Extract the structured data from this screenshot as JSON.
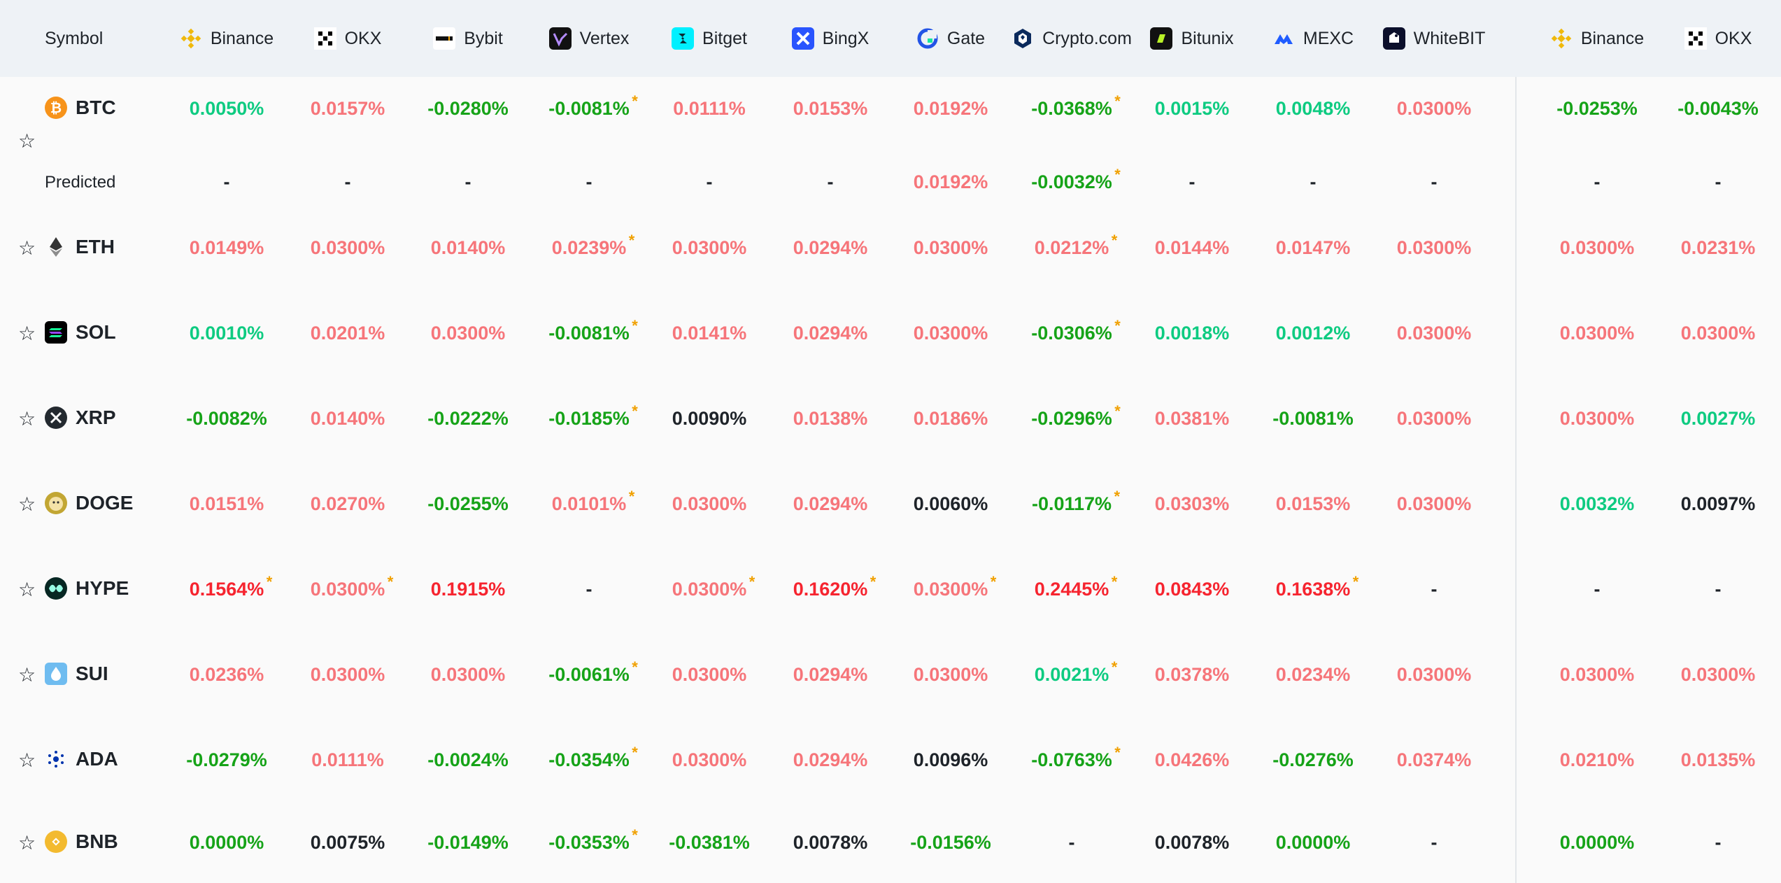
{
  "header": {
    "symbol_label": "Symbol",
    "exchanges": [
      {
        "name": "Binance",
        "icon": "binance-icon"
      },
      {
        "name": "OKX",
        "icon": "okx-icon"
      },
      {
        "name": "Bybit",
        "icon": "bybit-icon"
      },
      {
        "name": "Vertex",
        "icon": "vertex-icon"
      },
      {
        "name": "Bitget",
        "icon": "bitget-icon"
      },
      {
        "name": "BingX",
        "icon": "bingx-icon"
      },
      {
        "name": "Gate",
        "icon": "gate-icon"
      },
      {
        "name": "Crypto.com",
        "icon": "cryptocom-icon"
      },
      {
        "name": "Bitunix",
        "icon": "bitunix-icon"
      },
      {
        "name": "MEXC",
        "icon": "mexc-icon"
      },
      {
        "name": "WhiteBIT",
        "icon": "whitebit-icon"
      },
      {
        "name": "Binance",
        "icon": "binance-icon"
      },
      {
        "name": "OKX",
        "icon": "okx-icon"
      }
    ]
  },
  "predicted_label": "Predicted",
  "colors": {
    "positive_low": "#0ecb81",
    "negative": "#16a318",
    "positive": "#f6757a",
    "high": "#f6242f",
    "neutral": "#1e2329",
    "estimated_marker": "#f0a000"
  },
  "rows": [
    {
      "symbol": "BTC",
      "icon": "btc-icon",
      "rates": [
        {
          "v": "0.0050%",
          "c": "pos-green"
        },
        {
          "v": "0.0157%",
          "c": "pink"
        },
        {
          "v": "-0.0280%",
          "c": "neg-green"
        },
        {
          "v": "-0.0081%",
          "c": "neg-green",
          "a": true
        },
        {
          "v": "0.0111%",
          "c": "pink"
        },
        {
          "v": "0.0153%",
          "c": "pink"
        },
        {
          "v": "0.0192%",
          "c": "pink"
        },
        {
          "v": "-0.0368%",
          "c": "neg-green",
          "a": true
        },
        {
          "v": "0.0015%",
          "c": "pos-green"
        },
        {
          "v": "0.0048%",
          "c": "pos-green"
        },
        {
          "v": "0.0300%",
          "c": "pink"
        },
        {
          "v": "-0.0253%",
          "c": "neg-green"
        },
        {
          "v": "-0.0043%",
          "c": "neg-green"
        }
      ],
      "predicted": [
        {
          "v": "-",
          "c": "dark"
        },
        {
          "v": "-",
          "c": "dark"
        },
        {
          "v": "-",
          "c": "dark"
        },
        {
          "v": "-",
          "c": "dark"
        },
        {
          "v": "-",
          "c": "dark"
        },
        {
          "v": "-",
          "c": "dark"
        },
        {
          "v": "0.0192%",
          "c": "pink"
        },
        {
          "v": "-0.0032%",
          "c": "neg-green",
          "a": true
        },
        {
          "v": "-",
          "c": "dark"
        },
        {
          "v": "-",
          "c": "dark"
        },
        {
          "v": "-",
          "c": "dark"
        },
        {
          "v": "-",
          "c": "dark"
        },
        {
          "v": "-",
          "c": "dark"
        }
      ]
    },
    {
      "symbol": "ETH",
      "icon": "eth-icon",
      "rates": [
        {
          "v": "0.0149%",
          "c": "pink"
        },
        {
          "v": "0.0300%",
          "c": "pink"
        },
        {
          "v": "0.0140%",
          "c": "pink"
        },
        {
          "v": "0.0239%",
          "c": "pink",
          "a": true
        },
        {
          "v": "0.0300%",
          "c": "pink"
        },
        {
          "v": "0.0294%",
          "c": "pink"
        },
        {
          "v": "0.0300%",
          "c": "pink"
        },
        {
          "v": "0.0212%",
          "c": "pink",
          "a": true
        },
        {
          "v": "0.0144%",
          "c": "pink"
        },
        {
          "v": "0.0147%",
          "c": "pink"
        },
        {
          "v": "0.0300%",
          "c": "pink"
        },
        {
          "v": "0.0300%",
          "c": "pink"
        },
        {
          "v": "0.0231%",
          "c": "pink"
        }
      ]
    },
    {
      "symbol": "SOL",
      "icon": "sol-icon",
      "rates": [
        {
          "v": "0.0010%",
          "c": "pos-green"
        },
        {
          "v": "0.0201%",
          "c": "pink"
        },
        {
          "v": "0.0300%",
          "c": "pink"
        },
        {
          "v": "-0.0081%",
          "c": "neg-green",
          "a": true
        },
        {
          "v": "0.0141%",
          "c": "pink"
        },
        {
          "v": "0.0294%",
          "c": "pink"
        },
        {
          "v": "0.0300%",
          "c": "pink"
        },
        {
          "v": "-0.0306%",
          "c": "neg-green",
          "a": true
        },
        {
          "v": "0.0018%",
          "c": "pos-green"
        },
        {
          "v": "0.0012%",
          "c": "pos-green"
        },
        {
          "v": "0.0300%",
          "c": "pink"
        },
        {
          "v": "0.0300%",
          "c": "pink"
        },
        {
          "v": "0.0300%",
          "c": "pink"
        }
      ]
    },
    {
      "symbol": "XRP",
      "icon": "xrp-icon",
      "rates": [
        {
          "v": "-0.0082%",
          "c": "neg-green"
        },
        {
          "v": "0.0140%",
          "c": "pink"
        },
        {
          "v": "-0.0222%",
          "c": "neg-green"
        },
        {
          "v": "-0.0185%",
          "c": "neg-green",
          "a": true
        },
        {
          "v": "0.0090%",
          "c": "dark"
        },
        {
          "v": "0.0138%",
          "c": "pink"
        },
        {
          "v": "0.0186%",
          "c": "pink"
        },
        {
          "v": "-0.0296%",
          "c": "neg-green",
          "a": true
        },
        {
          "v": "0.0381%",
          "c": "pink"
        },
        {
          "v": "-0.0081%",
          "c": "neg-green"
        },
        {
          "v": "0.0300%",
          "c": "pink"
        },
        {
          "v": "0.0300%",
          "c": "pink"
        },
        {
          "v": "0.0027%",
          "c": "pos-green"
        }
      ]
    },
    {
      "symbol": "DOGE",
      "icon": "doge-icon",
      "rates": [
        {
          "v": "0.0151%",
          "c": "pink"
        },
        {
          "v": "0.0270%",
          "c": "pink"
        },
        {
          "v": "-0.0255%",
          "c": "neg-green"
        },
        {
          "v": "0.0101%",
          "c": "pink",
          "a": true
        },
        {
          "v": "0.0300%",
          "c": "pink"
        },
        {
          "v": "0.0294%",
          "c": "pink"
        },
        {
          "v": "0.0060%",
          "c": "dark"
        },
        {
          "v": "-0.0117%",
          "c": "neg-green",
          "a": true
        },
        {
          "v": "0.0303%",
          "c": "pink"
        },
        {
          "v": "0.0153%",
          "c": "pink"
        },
        {
          "v": "0.0300%",
          "c": "pink"
        },
        {
          "v": "0.0032%",
          "c": "pos-green"
        },
        {
          "v": "0.0097%",
          "c": "dark"
        }
      ]
    },
    {
      "symbol": "HYPE",
      "icon": "hype-icon",
      "rates": [
        {
          "v": "0.1564%",
          "c": "red",
          "a": true
        },
        {
          "v": "0.0300%",
          "c": "pink",
          "a": true
        },
        {
          "v": "0.1915%",
          "c": "red"
        },
        {
          "v": "-",
          "c": "dark"
        },
        {
          "v": "0.0300%",
          "c": "pink",
          "a": true
        },
        {
          "v": "0.1620%",
          "c": "red",
          "a": true
        },
        {
          "v": "0.0300%",
          "c": "pink",
          "a": true
        },
        {
          "v": "0.2445%",
          "c": "red",
          "a": true
        },
        {
          "v": "0.0843%",
          "c": "red"
        },
        {
          "v": "0.1638%",
          "c": "red",
          "a": true
        },
        {
          "v": "-",
          "c": "dark"
        },
        {
          "v": "-",
          "c": "dark"
        },
        {
          "v": "-",
          "c": "dark"
        }
      ]
    },
    {
      "symbol": "SUI",
      "icon": "sui-icon",
      "rates": [
        {
          "v": "0.0236%",
          "c": "pink"
        },
        {
          "v": "0.0300%",
          "c": "pink"
        },
        {
          "v": "0.0300%",
          "c": "pink"
        },
        {
          "v": "-0.0061%",
          "c": "neg-green",
          "a": true
        },
        {
          "v": "0.0300%",
          "c": "pink"
        },
        {
          "v": "0.0294%",
          "c": "pink"
        },
        {
          "v": "0.0300%",
          "c": "pink"
        },
        {
          "v": "0.0021%",
          "c": "pos-green",
          "a": true
        },
        {
          "v": "0.0378%",
          "c": "pink"
        },
        {
          "v": "0.0234%",
          "c": "pink"
        },
        {
          "v": "0.0300%",
          "c": "pink"
        },
        {
          "v": "0.0300%",
          "c": "pink"
        },
        {
          "v": "0.0300%",
          "c": "pink"
        }
      ]
    },
    {
      "symbol": "ADA",
      "icon": "ada-icon",
      "rates": [
        {
          "v": "-0.0279%",
          "c": "neg-green"
        },
        {
          "v": "0.0111%",
          "c": "pink"
        },
        {
          "v": "-0.0024%",
          "c": "neg-green"
        },
        {
          "v": "-0.0354%",
          "c": "neg-green",
          "a": true
        },
        {
          "v": "0.0300%",
          "c": "pink"
        },
        {
          "v": "0.0294%",
          "c": "pink"
        },
        {
          "v": "0.0096%",
          "c": "dark"
        },
        {
          "v": "-0.0763%",
          "c": "neg-green",
          "a": true
        },
        {
          "v": "0.0426%",
          "c": "pink"
        },
        {
          "v": "-0.0276%",
          "c": "neg-green"
        },
        {
          "v": "0.0374%",
          "c": "pink"
        },
        {
          "v": "0.0210%",
          "c": "pink"
        },
        {
          "v": "0.0135%",
          "c": "pink"
        }
      ]
    },
    {
      "symbol": "BNB",
      "icon": "bnb-icon",
      "rates": [
        {
          "v": "0.0000%",
          "c": "neg-green"
        },
        {
          "v": "0.0075%",
          "c": "dark"
        },
        {
          "v": "-0.0149%",
          "c": "neg-green"
        },
        {
          "v": "-0.0353%",
          "c": "neg-green",
          "a": true
        },
        {
          "v": "-0.0381%",
          "c": "neg-green"
        },
        {
          "v": "0.0078%",
          "c": "dark"
        },
        {
          "v": "-0.0156%",
          "c": "neg-green"
        },
        {
          "v": "-",
          "c": "dark"
        },
        {
          "v": "0.0078%",
          "c": "dark"
        },
        {
          "v": "0.0000%",
          "c": "neg-green"
        },
        {
          "v": "-",
          "c": "dark"
        },
        {
          "v": "0.0000%",
          "c": "neg-green"
        },
        {
          "v": "-",
          "c": "dark"
        }
      ]
    }
  ]
}
